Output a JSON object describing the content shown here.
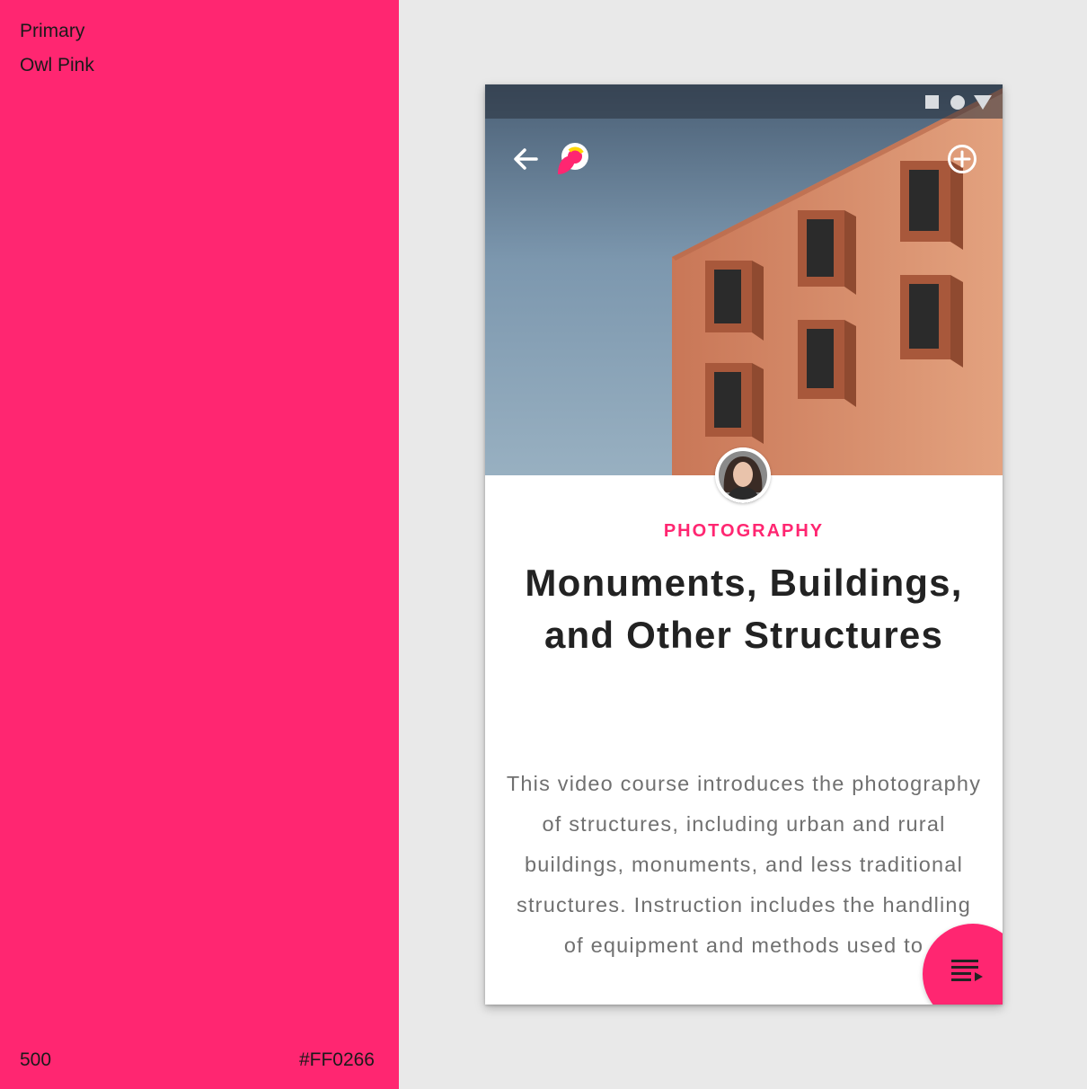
{
  "swatch": {
    "label_primary": "Primary",
    "color_name": "Owl Pink",
    "tone": "500",
    "hex": "#FF0266",
    "color": "#FF2671"
  },
  "status_bar": {
    "icons": [
      "square-icon",
      "circle-icon",
      "triangle-icon"
    ]
  },
  "app_bar": {
    "back_icon": "arrow-left-icon",
    "logo_icon": "owl-logo-icon",
    "add_icon": "add-circle-icon"
  },
  "course": {
    "category": "PHOTOGRAPHY",
    "title": "Monuments, Buildings, and Other Structures",
    "description": "This video course introduces the photography of structures, including urban and rural buildings, monuments, and less traditional structures. Instruction includes the handling of equipment and methods used to"
  },
  "fab": {
    "icon": "playlist-icon"
  },
  "accent": "#FF2671"
}
